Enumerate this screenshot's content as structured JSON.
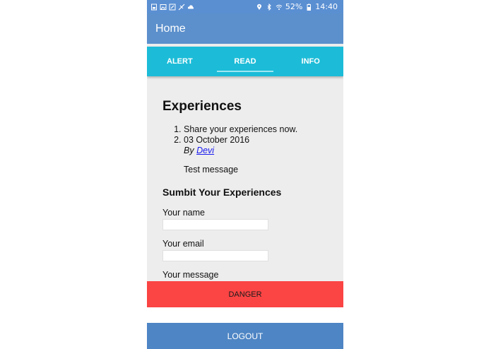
{
  "status_bar": {
    "battery": "52%",
    "time": "14:40",
    "left_icons": [
      "sim-icon",
      "image-icon",
      "edit-icon",
      "no-signal-icon",
      "cloud-icon"
    ],
    "right_icons": [
      "location-icon",
      "bluetooth-icon",
      "wifi-icon",
      "battery-icon"
    ]
  },
  "appbar": {
    "title": "Home"
  },
  "tabs": [
    {
      "label": "ALERT"
    },
    {
      "label": "READ"
    },
    {
      "label": "INFO"
    }
  ],
  "active_tab": "READ",
  "content": {
    "heading": "Experiences",
    "list": [
      {
        "text": "Share your experiences now."
      },
      {
        "date": "03 October 2016",
        "by_prefix": "By",
        "author": "Devi",
        "message": "Test message"
      }
    ],
    "form_title": "Sumbit Your Experiences",
    "fields": {
      "name_label": "Your name",
      "email_label": "Your email",
      "message_label": "Your message"
    }
  },
  "buttons": {
    "danger": "DANGER",
    "logout": "LOGOUT"
  },
  "colors": {
    "status_bar": "#5a8fd2",
    "app_bar": "#5c90cc",
    "tabs": "#1cbcd8",
    "danger": "#fb4444",
    "logout": "#4e85c4"
  }
}
